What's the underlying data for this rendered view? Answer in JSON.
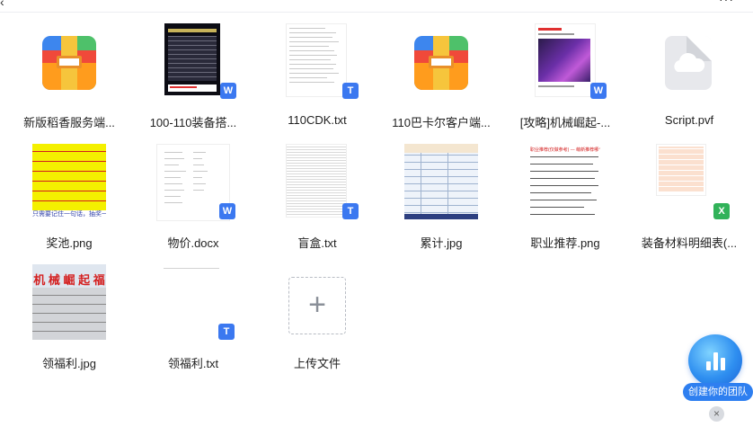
{
  "files": [
    {
      "name": "新版稻香服务端...",
      "kind": "archive"
    },
    {
      "name": "100-110装备搭...",
      "kind": "docx",
      "badge": "W"
    },
    {
      "name": "110CDK.txt",
      "kind": "txt",
      "badge": "T"
    },
    {
      "name": "110巴卡尔客户端...",
      "kind": "archive"
    },
    {
      "name": "[攻略]机械崛起-...",
      "kind": "docx",
      "badge": "W"
    },
    {
      "name": "Script.pvf",
      "kind": "pvf"
    },
    {
      "name": "奖池.png",
      "kind": "png"
    },
    {
      "name": "物价.docx",
      "kind": "docx",
      "badge": "W"
    },
    {
      "name": "盲盒.txt",
      "kind": "txt",
      "badge": "T"
    },
    {
      "name": "累计.jpg",
      "kind": "jpg"
    },
    {
      "name": "职业推荐.png",
      "kind": "png"
    },
    {
      "name": "装备材料明细表(...",
      "kind": "xlsx",
      "badge": "X"
    },
    {
      "name": "领福利.jpg",
      "kind": "jpg"
    },
    {
      "name": "领福利.txt",
      "kind": "txt",
      "badge": "T"
    }
  ],
  "upload": {
    "label": "上传文件",
    "symbol": "+"
  },
  "team_widget": {
    "label": "创建你的团队",
    "close": "×"
  },
  "thumb_text": {
    "welfare_title": "机 械 崛 起 福",
    "jiangchi_footer": "只需要记住一句话，抽奖一回就",
    "career_title": "职业推荐(仅做参考) --- 萌新推荐哪个"
  },
  "colors": {
    "accent": "#3b78f0",
    "excel": "#31b259",
    "team": "#2e7ff0"
  }
}
